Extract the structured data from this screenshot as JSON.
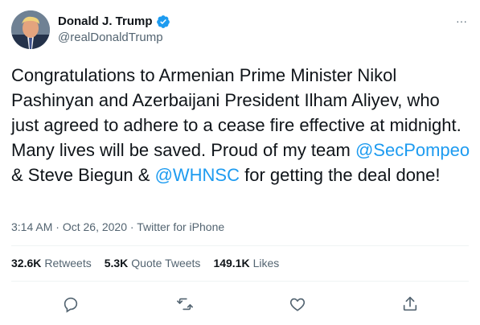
{
  "user": {
    "display_name": "Donald J. Trump",
    "handle": "@realDonaldTrump",
    "verified": true
  },
  "more_icon": "···",
  "tweet": {
    "text_before": "Congratulations to Armenian Prime Minister Nikol Pashinyan and Azerbaijani President Ilham Aliyev, who just agreed to adhere to a cease fire effective at midnight. Many lives will be saved. Proud of my team ",
    "mention1": "@SecPompeo",
    "text_middle": " & Steve Biegun & ",
    "mention2": "@WHNSC",
    "text_after": " for getting the deal done!"
  },
  "meta": {
    "time": "3:14 AM",
    "sep1": " · ",
    "date": "Oct 26, 2020",
    "sep2": " · ",
    "source": "Twitter for iPhone"
  },
  "stats": {
    "retweets_count": "32.6K",
    "retweets_label": "Retweets",
    "quotes_count": "5.3K",
    "quotes_label": "Quote Tweets",
    "likes_count": "149.1K",
    "likes_label": "Likes"
  },
  "colors": {
    "accent": "#1d9bf0",
    "text": "#0f1419",
    "muted": "#536471"
  },
  "icons": [
    "reply-icon",
    "retweet-icon",
    "like-icon",
    "share-icon",
    "verified-badge-icon",
    "more-icon"
  ]
}
